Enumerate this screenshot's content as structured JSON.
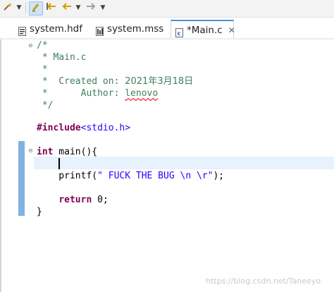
{
  "toolbar": {
    "items": [
      "wand-icon",
      "dropdown-arrow",
      "highlight-icon",
      "back-edit-icon",
      "back-icon",
      "forward-icon"
    ]
  },
  "tabs": [
    {
      "label": "system.hdf",
      "icon": "file-hdf-icon",
      "active": false
    },
    {
      "label": "system.mss",
      "icon": "file-mss-icon",
      "active": false
    },
    {
      "label": "*Main.c",
      "icon": "c-file-icon",
      "active": true,
      "close": "✕"
    }
  ],
  "code": {
    "c1": "/*",
    "c2": " * Main.c",
    "c3": " *",
    "c4_prefix": " *  Created on: ",
    "c4_date": "2021年3月18日",
    "c5_prefix": " *      Author: ",
    "c5_author": "lenovo",
    "c6": " */",
    "include_kw": "#include",
    "include_hdr": "<stdio.h>",
    "main_kw": "int",
    "main_rest": " main(){",
    "printf_pre": "    printf(",
    "printf_str": "\" FUCK THE BUG \\n \\r\"",
    "printf_post": ");",
    "return_kw": "return",
    "return_rest": " 0;",
    "return_indent": "    ",
    "close_brace": "}"
  },
  "watermark": "https://blog.csdn.net/Taneeyo"
}
